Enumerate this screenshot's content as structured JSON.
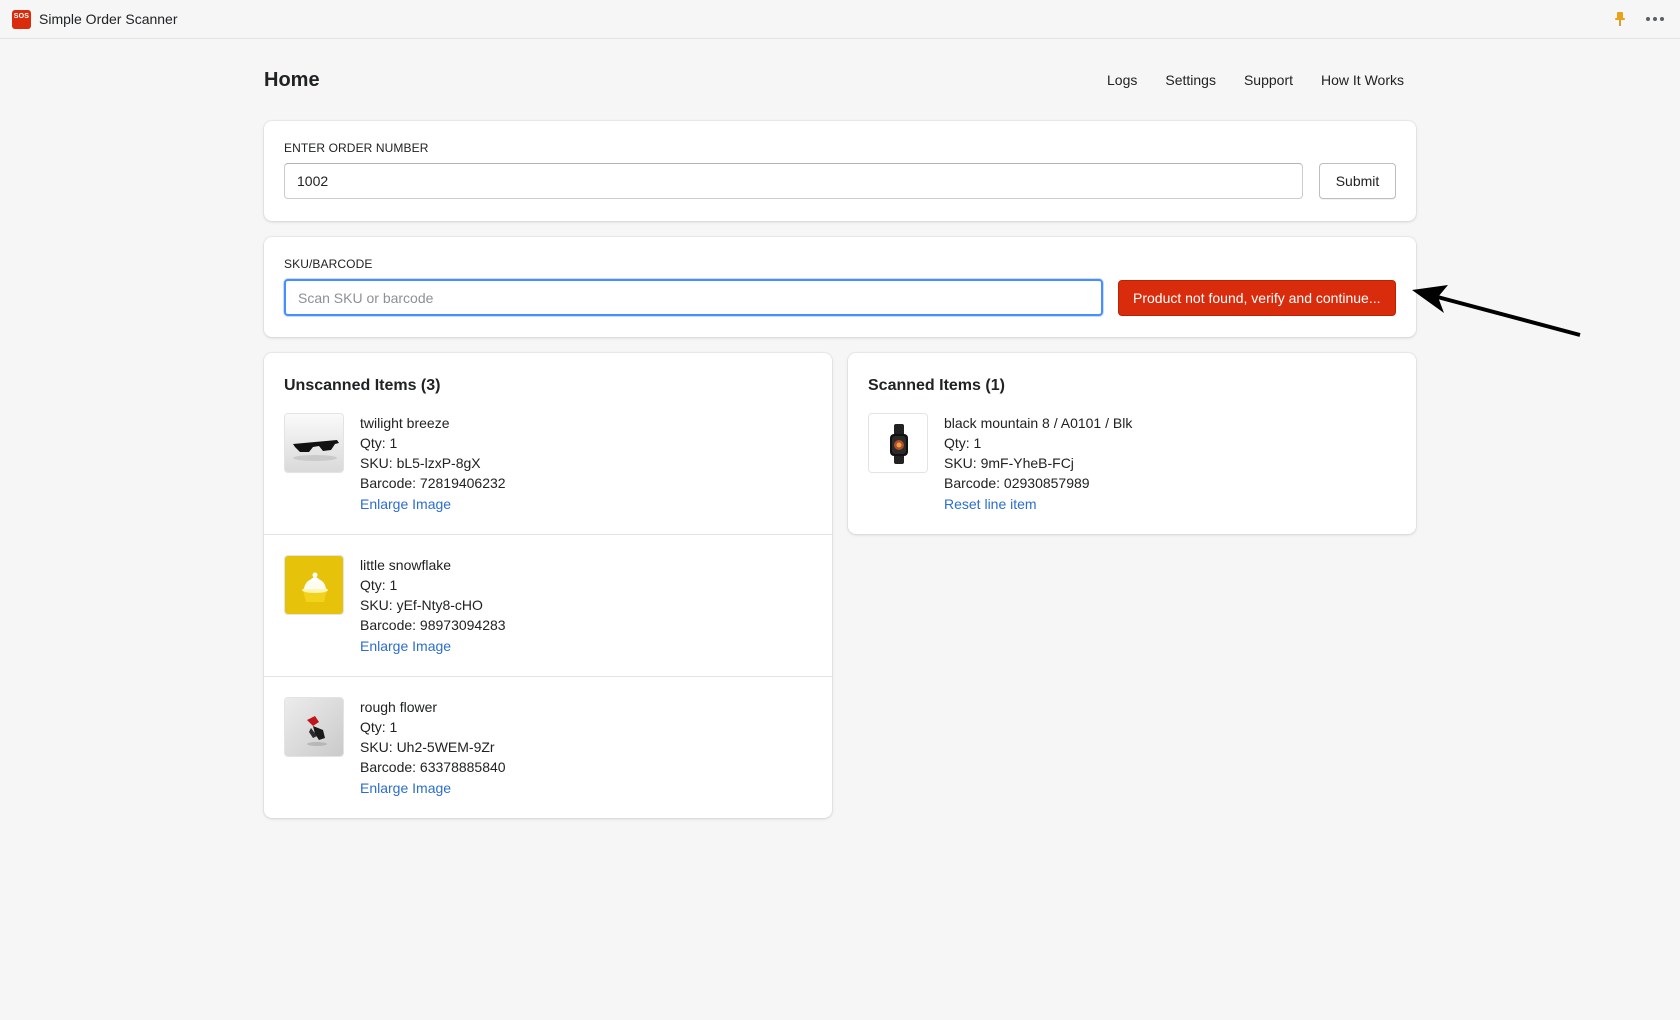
{
  "app": {
    "logo_text": "SOS",
    "title": "Simple Order Scanner"
  },
  "page": {
    "title": "Home",
    "nav": [
      "Logs",
      "Settings",
      "Support",
      "How It Works"
    ]
  },
  "order": {
    "label": "ENTER ORDER NUMBER",
    "value": "1002",
    "submit_label": "Submit"
  },
  "sku": {
    "label": "SKU/BARCODE",
    "placeholder": "Scan SKU or barcode",
    "status_button_label": "Product not found, verify and continue..."
  },
  "unscanned": {
    "title": "Unscanned Items (3)",
    "items": [
      {
        "name": "twilight breeze",
        "qty": "Qty: 1",
        "sku": "SKU: bL5-lzxP-8gX",
        "barcode": "Barcode: 72819406232",
        "link": "Enlarge Image",
        "image": "sunglasses"
      },
      {
        "name": "little snowflake",
        "qty": "Qty: 1",
        "sku": "SKU: yEf-Nty8-cHO",
        "barcode": "Barcode: 98973094283",
        "link": "Enlarge Image",
        "image": "cupcake"
      },
      {
        "name": "rough flower",
        "qty": "Qty: 1",
        "sku": "SKU: Uh2-5WEM-9Zr",
        "barcode": "Barcode: 63378885840",
        "link": "Enlarge Image",
        "image": "flower"
      }
    ]
  },
  "scanned": {
    "title": "Scanned Items (1)",
    "items": [
      {
        "name": "black mountain 8 / A0101 / Blk",
        "qty": "Qty: 1",
        "sku": "SKU: 9mF-YheB-FCj",
        "barcode": "Barcode: 02930857989",
        "link": "Reset line item",
        "image": "watch"
      }
    ]
  },
  "colors": {
    "danger": "#d82c0d",
    "link": "#2c6ecb",
    "focus": "#458fff",
    "pin": "#e8a317"
  }
}
